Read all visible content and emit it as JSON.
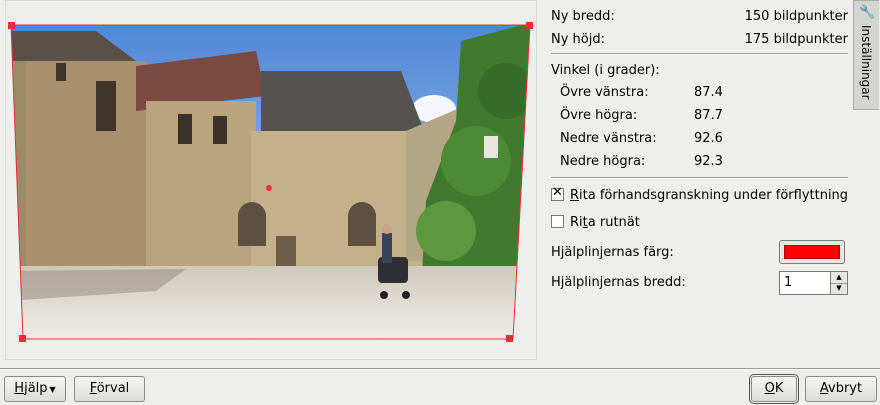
{
  "dimensions": {
    "new_width_label": "Ny bredd:",
    "new_width_value": "150 bildpunkter",
    "new_height_label": "Ny höjd:",
    "new_height_value": "175 bildpunkter"
  },
  "angles": {
    "heading": "Vinkel (i grader):",
    "items": [
      {
        "label": "Övre vänstra:",
        "value": "87.4"
      },
      {
        "label": "Övre högra:",
        "value": "87.7"
      },
      {
        "label": "Nedre vänstra:",
        "value": "92.6"
      },
      {
        "label": "Nedre högra:",
        "value": "92.3"
      }
    ]
  },
  "options": {
    "preview_during_move": {
      "label_first": "R",
      "label_rest": "ita förhandsgranskning under förflyttning",
      "checked": true
    },
    "draw_grid": {
      "label_first": "R",
      "label_mid": "i",
      "label_u": "t",
      "label_rest": "a rutnät",
      "checked": false
    }
  },
  "guide": {
    "color_label": "Hjälplinjernas färg:",
    "color_value": "#ff0000",
    "width_label": "Hjälplinjernas bredd:",
    "width_value": "1"
  },
  "side_tab": {
    "label": "Inställningar",
    "icon": "wrench-icon"
  },
  "buttons": {
    "help_first": "H",
    "help_rest": "jälp",
    "defaults_first": "F",
    "defaults_rest": "örval",
    "ok_first": "O",
    "ok_rest": "K",
    "cancel_first": "A",
    "cancel_rest": "vbryt"
  },
  "colors": {
    "guide_line": "#e8303a",
    "handle": "#e8303a"
  }
}
